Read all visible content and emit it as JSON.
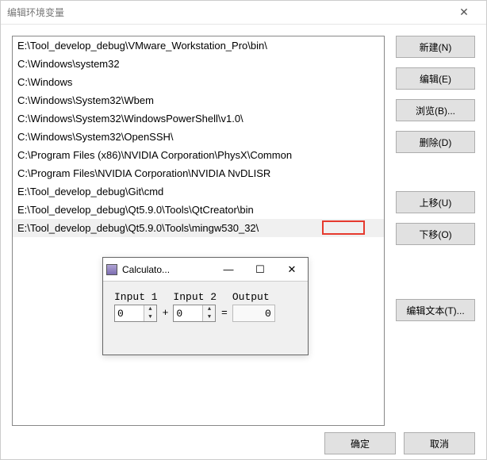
{
  "dialog": {
    "title": "编辑环境变量",
    "close_glyph": "✕"
  },
  "entries": [
    "E:\\Tool_develop_debug\\VMware_Workstation_Pro\\bin\\",
    "C:\\Windows\\system32",
    "C:\\Windows",
    "C:\\Windows\\System32\\Wbem",
    "C:\\Windows\\System32\\WindowsPowerShell\\v1.0\\",
    "C:\\Windows\\System32\\OpenSSH\\",
    "C:\\Program Files (x86)\\NVIDIA Corporation\\PhysX\\Common",
    "C:\\Program Files\\NVIDIA Corporation\\NVIDIA NvDLISR",
    "E:\\Tool_develop_debug\\Git\\cmd",
    "E:\\Tool_develop_debug\\Qt5.9.0\\Tools\\QtCreator\\bin",
    "E:\\Tool_develop_debug\\Qt5.9.0\\Tools\\mingw530_32\\"
  ],
  "selected_index": 10,
  "buttons": {
    "new": "新建(N)",
    "edit": "编辑(E)",
    "browse": "浏览(B)...",
    "delete": "删除(D)",
    "moveup": "上移(U)",
    "movedown": "下移(O)",
    "edittext": "编辑文本(T)...",
    "ok": "确定",
    "cancel": "取消"
  },
  "calc": {
    "title": "Calculato...",
    "minimize": "—",
    "maximize": "☐",
    "close": "✕",
    "input1_label": "Input 1",
    "input2_label": "Input 2",
    "output_label": "Output",
    "plus": "+",
    "equals": "=",
    "input1_value": "0",
    "input2_value": "0",
    "output_value": "0"
  }
}
